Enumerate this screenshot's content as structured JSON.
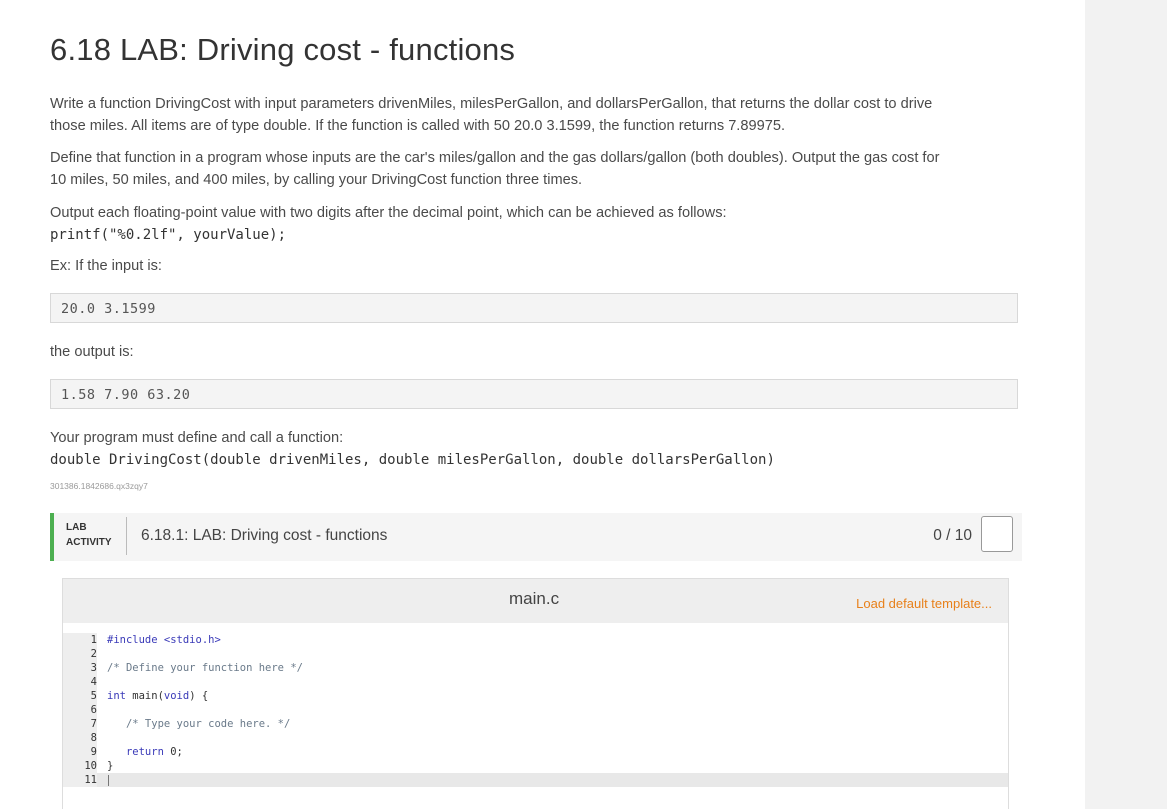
{
  "page": {
    "title": "6.18 LAB: Driving cost - functions",
    "p1_line1": "Write a function DrivingCost with input parameters drivenMiles, milesPerGallon, and dollarsPerGallon, that returns the dollar cost to drive",
    "p1_line2": "those miles. All items are of type double. If the function is called with 50 20.0 3.1599, the function returns 7.89975.",
    "p2_line1": "Define that function in a program whose inputs are the car's miles/gallon and the gas dollars/gallon (both doubles). Output the gas cost for",
    "p2_line2": "10 miles, 50 miles, and 400 miles, by calling your DrivingCost function three times.",
    "p3": "Output each floating-point value with two digits after the decimal point, which can be achieved as follows:",
    "printf_code": "printf(\"%0.2lf\", yourValue);",
    "ex_label": "Ex: If the input is:",
    "example_input": "20.0 3.1599",
    "output_label": "the output is:",
    "example_output": "1.58 7.90 63.20",
    "define_label": "Your program must define and call a function:",
    "signature": "double DrivingCost(double drivenMiles, double milesPerGallon, double dollarsPerGallon)",
    "activity_id": "301386.1842686.qx3zqy7"
  },
  "lab": {
    "label_line1": "LAB",
    "label_line2": "ACTIVITY",
    "title": "6.18.1: LAB: Driving cost - functions",
    "score": "0 / 10",
    "accent_color": "#4caf50"
  },
  "editor": {
    "filename": "main.c",
    "load_default": "Load default template...",
    "lines": [
      {
        "n": "1",
        "text": "#include <stdio.h>"
      },
      {
        "n": "2",
        "text": ""
      },
      {
        "n": "3",
        "text": "/* Define your function here */"
      },
      {
        "n": "4",
        "text": ""
      },
      {
        "n": "5",
        "text": "int main(void) {"
      },
      {
        "n": "6",
        "text": ""
      },
      {
        "n": "7",
        "text": "   /* Type your code here. */"
      },
      {
        "n": "8",
        "text": ""
      },
      {
        "n": "9",
        "text": "   return 0;"
      },
      {
        "n": "10",
        "text": "}"
      },
      {
        "n": "11",
        "text": ""
      }
    ]
  }
}
